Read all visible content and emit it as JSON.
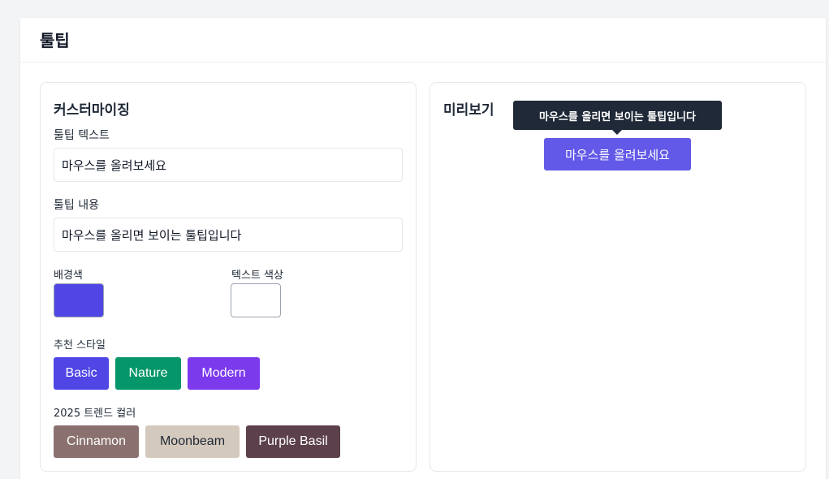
{
  "page": {
    "title": "툴팁"
  },
  "customize": {
    "section_title": "커스터마이징",
    "tooltip_text_label": "툴팁 텍스트",
    "tooltip_text_value": "마우스를 올려보세요",
    "tooltip_content_label": "툴팁 내용",
    "tooltip_content_value": "마우스를 올리면 보이는 툴팁입니다",
    "bg_color_label": "배경색",
    "bg_color_value": "#4f46e5",
    "text_color_label": "텍스트 색상",
    "text_color_value": "#ffffff",
    "recommended_label": "추천 스타일",
    "recommended_styles": [
      {
        "label": "Basic",
        "bg": "#4f46e5",
        "fg": "#ffffff"
      },
      {
        "label": "Nature",
        "bg": "#059669",
        "fg": "#ffffff"
      },
      {
        "label": "Modern",
        "bg": "#7c3aed",
        "fg": "#ffffff"
      }
    ],
    "trend_label": "2025 트렌드 컬러",
    "trend_colors": [
      {
        "label": "Cinnamon",
        "bg": "#8a716f",
        "fg": "#ffffff"
      },
      {
        "label": "Moonbeam",
        "bg": "#d4c9bd",
        "fg": "#1f2937"
      },
      {
        "label": "Purple Basil",
        "bg": "#5c404b",
        "fg": "#ffffff"
      }
    ]
  },
  "preview": {
    "section_title": "미리보기",
    "tooltip_text": "마우스를 올리면 보이는 툴팁입니다",
    "button_label": "마우스를 올려보세요",
    "button_bg": "#6259e8",
    "tooltip_bg": "#1f2937"
  }
}
